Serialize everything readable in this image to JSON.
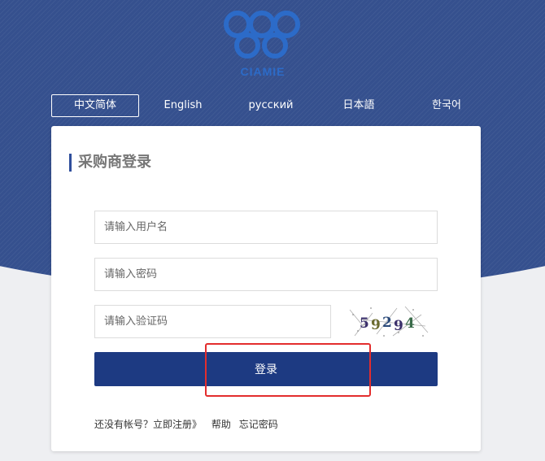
{
  "brand": {
    "logo_text": "CIAMIE"
  },
  "languages": [
    {
      "label": "中文简体",
      "active": true
    },
    {
      "label": "English",
      "active": false
    },
    {
      "label": "русский",
      "active": false
    },
    {
      "label": "日本語",
      "active": false
    },
    {
      "label": "한국어",
      "active": false
    }
  ],
  "login": {
    "title": "采购商登录",
    "username_placeholder": "请输入用户名",
    "password_placeholder": "请输入密码",
    "captcha_placeholder": "请输入验证码",
    "captcha_text": "59294",
    "submit_label": "登录"
  },
  "footer_links": {
    "no_account": "还没有帐号？",
    "register": "立即注册》",
    "help": "帮助",
    "forgot": "忘记密码"
  },
  "colors": {
    "hero_bg": "#35508e",
    "button_bg": "#1d3a82",
    "highlight": "#e32d2d"
  }
}
